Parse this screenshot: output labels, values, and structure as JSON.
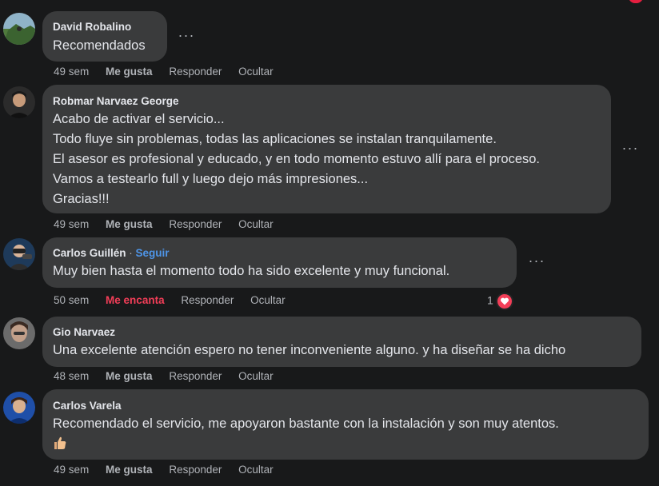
{
  "comments": [
    {
      "author": "David Robalino",
      "lines": [
        "Recomendados"
      ],
      "time": "49 sem",
      "like": "Me gusta",
      "reply": "Responder",
      "hide": "Ocultar"
    },
    {
      "author": "Robmar Narvaez George",
      "lines": [
        "Acabo de activar el servicio...",
        "Todo fluye sin problemas, todas las aplicaciones se instalan tranquilamente.",
        "El asesor es profesional y educado, y en todo momento estuvo allí para el proceso.",
        "Vamos a testearlo full y luego dejo más impresiones...",
        "Gracias!!!"
      ],
      "time": "49 sem",
      "like": "Me gusta",
      "reply": "Responder",
      "hide": "Ocultar"
    },
    {
      "author": "Carlos Guillén",
      "follow_sep": " · ",
      "follow": "Seguir",
      "lines": [
        "Muy bien hasta el momento todo ha sido excelente y muy funcional."
      ],
      "time": "50 sem",
      "like": "Me encanta",
      "reply": "Responder",
      "hide": "Ocultar",
      "reaction_count": "1",
      "reaction_icon": "heart-icon"
    },
    {
      "author": "Gio Narvaez",
      "lines": [
        "Una excelente atención espero no tener inconveniente alguno. y ha diseñar se ha dicho"
      ],
      "time": "48 sem",
      "like": "Me gusta",
      "reply": "Responder",
      "hide": "Ocultar"
    },
    {
      "author": "Carlos Varela",
      "lines": [
        "Recomendado el servicio, me apoyaron bastante con la instalación y son muy atentos."
      ],
      "emoji": "thumbs-up-icon",
      "time": "49 sem",
      "like": "Me gusta",
      "reply": "Responder",
      "hide": "Ocultar"
    }
  ],
  "more_options": "···",
  "colors": {
    "background": "#18191a",
    "bubble": "#3a3b3c",
    "text": "#e4e6eb",
    "muted": "#b0b3b8",
    "link": "#4e95e8",
    "love": "#f33e58"
  }
}
